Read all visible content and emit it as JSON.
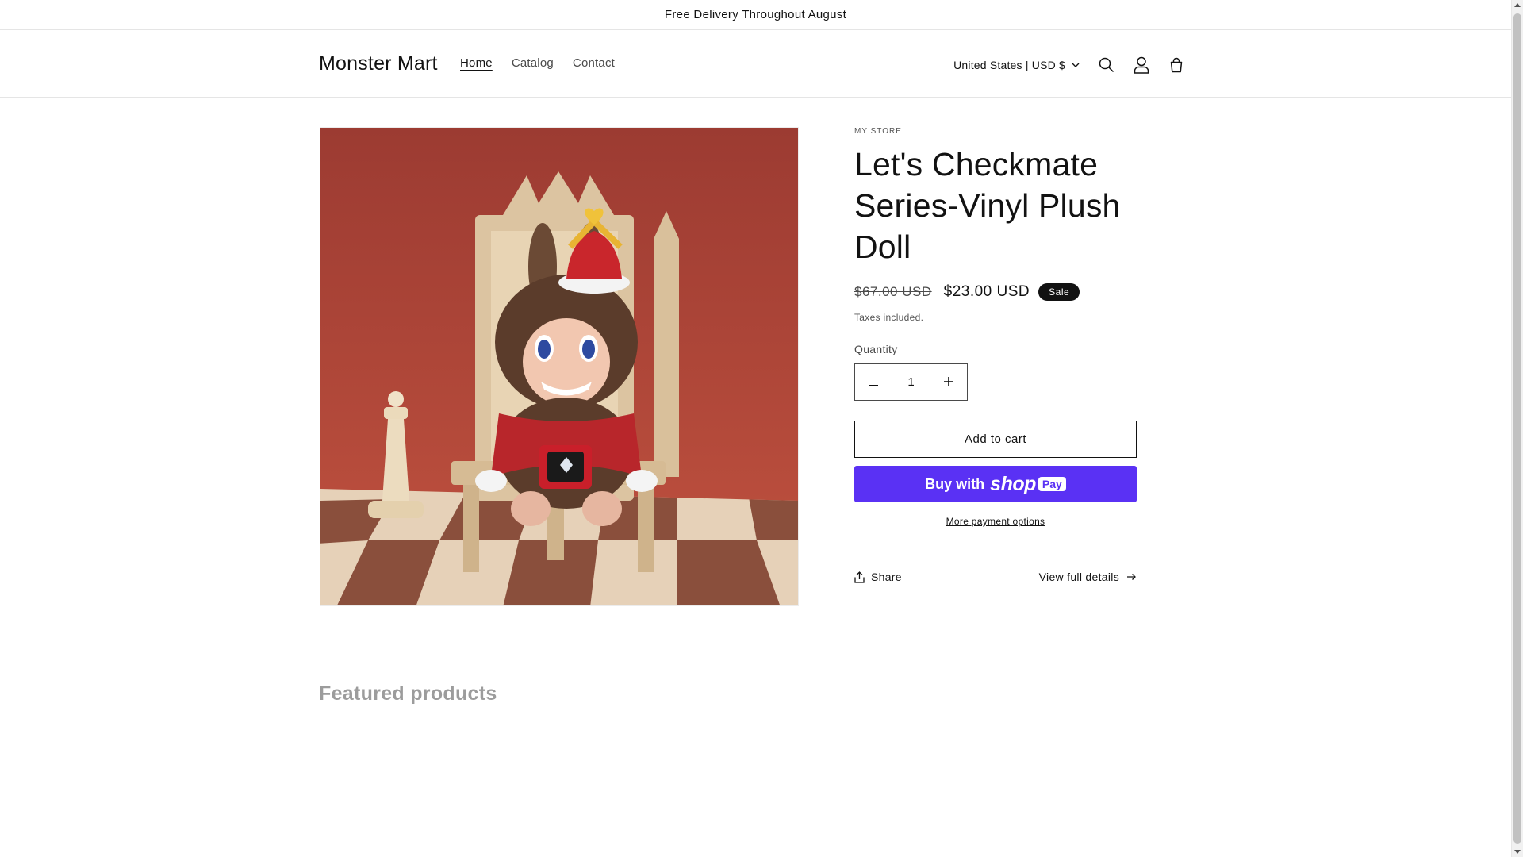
{
  "announcement": "Free Delivery Throughout August",
  "header": {
    "logo": "Monster Mart",
    "nav": [
      {
        "label": "Home",
        "active": true
      },
      {
        "label": "Catalog",
        "active": false
      },
      {
        "label": "Contact",
        "active": false
      }
    ],
    "country_selector": "United States | USD $",
    "icons": [
      "search-icon",
      "account-icon",
      "cart-icon"
    ]
  },
  "product": {
    "vendor": "MY STORE",
    "title": "Let's Checkmate Series-Vinyl Plush Doll",
    "price_regular": "$67.00 USD",
    "price_sale": "$23.00 USD",
    "badge": "Sale",
    "taxes_note": "Taxes included.",
    "quantity_label": "Quantity",
    "quantity_value": "1",
    "add_to_cart": "Add to cart",
    "buy_with": "Buy with",
    "shop_word": "shop",
    "pay_word": "Pay",
    "more_payment": "More payment options",
    "share": "Share",
    "view_details": "View full details"
  },
  "featured_heading": "Featured products",
  "colors": {
    "shop_pay": "#5a31f4",
    "badge": "#121212",
    "photo_background": "#b3453b",
    "checker_light": "#e8d3bb",
    "checker_dark": "#8a4f3c"
  }
}
